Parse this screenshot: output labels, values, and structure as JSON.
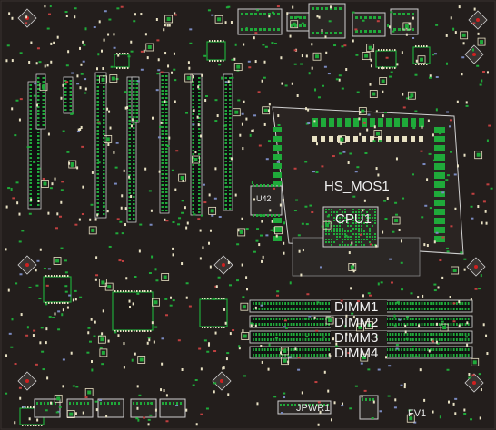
{
  "labels": {
    "hs_mos": "HS_MOS1",
    "cpu": "CPU1",
    "u42": "U42",
    "dimm1": "DIMM1",
    "dimm2": "DIMM2",
    "dimm3": "DIMM3",
    "dimm4": "DIMM4",
    "jpwr": "JPWR1",
    "fv": "FV1"
  },
  "colors": {
    "background": "#231e1c",
    "pad_green": "#1faa3a",
    "pad_cream": "#e9e2c4",
    "outline": "#cfcfcf",
    "slot_dark": "#111111",
    "red_mark": "#d02020"
  }
}
